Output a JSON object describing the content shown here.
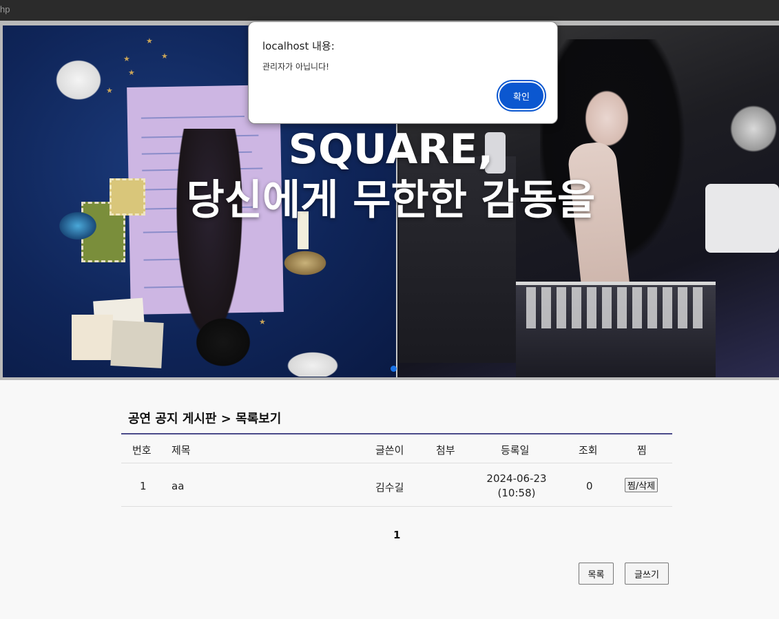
{
  "browser": {
    "tab_text": "hp"
  },
  "hero": {
    "title_line1": "SQUARE,",
    "title_line2": "당신에게 무한한 감동을"
  },
  "dialog": {
    "title": "localhost 내용:",
    "message": "관리자가 아닙니다!",
    "ok_label": "확인",
    "accent_color": "#0b57d0"
  },
  "board": {
    "title": "공연 공지 게시판 > 목록보기",
    "columns": {
      "no": "번호",
      "subject": "제목",
      "author": "글쓴이",
      "attach": "첨부",
      "date": "등록일",
      "views": "조회",
      "fav": "찜"
    },
    "rows": [
      {
        "no": "1",
        "subject": "aa",
        "author": "김수길",
        "attach": "",
        "date_line1": "2024-06-23",
        "date_line2": "(10:58)",
        "views": "0",
        "fav_button": "찜/삭제"
      }
    ],
    "pagination": {
      "current": "1"
    },
    "buttons": {
      "list": "목록",
      "write": "글쓰기"
    }
  }
}
